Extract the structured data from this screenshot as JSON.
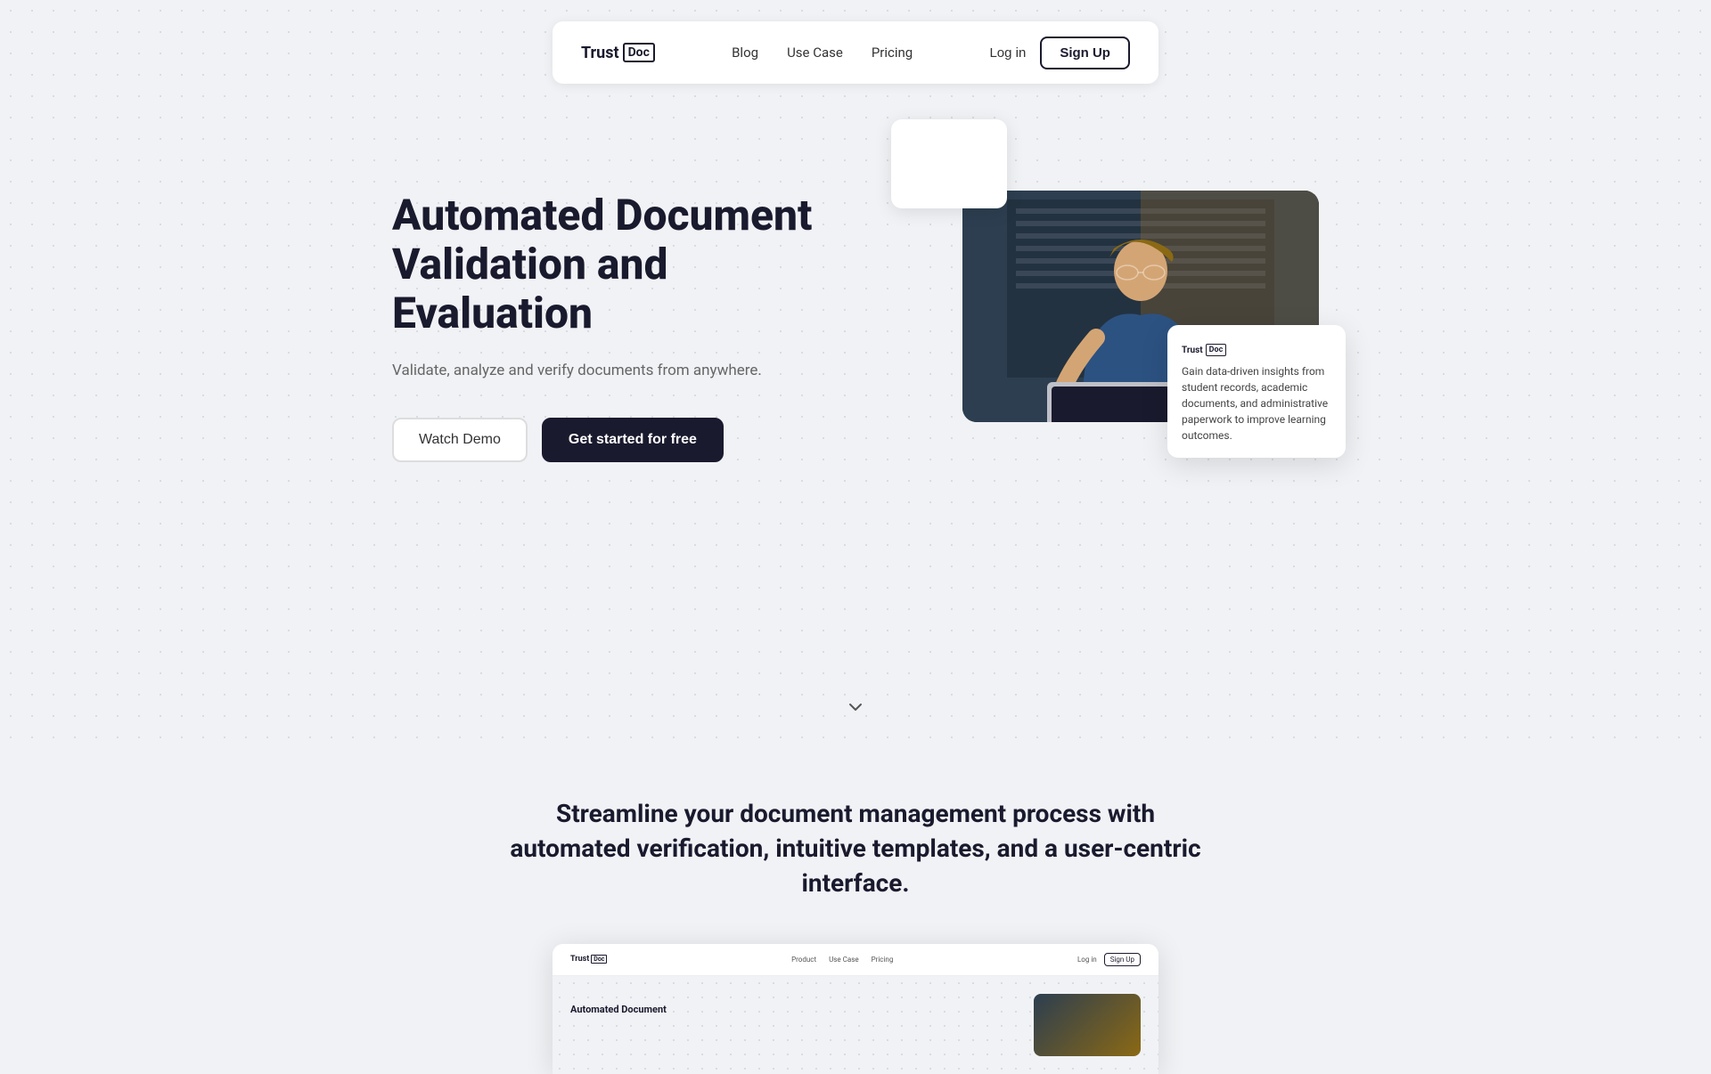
{
  "navbar": {
    "logo": {
      "prefix": "Trust",
      "box_text": "Doc"
    },
    "links": [
      {
        "label": "Blog",
        "id": "blog"
      },
      {
        "label": "Use Case",
        "id": "use-case"
      },
      {
        "label": "Pricing",
        "id": "pricing"
      }
    ],
    "login_label": "Log in",
    "signup_label": "Sign Up"
  },
  "hero": {
    "title": "Automated Document Validation and Evaluation",
    "subtitle": "Validate, analyze and verify documents from anywhere.",
    "watch_demo_label": "Watch Demo",
    "get_started_label": "Get started for free",
    "info_card": {
      "logo_prefix": "Trust",
      "logo_box": "Doc",
      "text": "Gain data-driven insights from student records, academic documents, and administrative paperwork to improve learning outcomes."
    }
  },
  "scroll_indicator": {
    "icon": "chevron-down"
  },
  "features": {
    "title": "Streamline your document management process with automated verification, intuitive templates, and a user-centric interface."
  },
  "preview": {
    "logo_prefix": "Trust",
    "logo_box": "Doc",
    "nav_links": [
      "Product",
      "Use Case",
      "Pricing"
    ],
    "login": "Log in",
    "signup": "Sign Up",
    "hero_text": "Automated Document"
  }
}
